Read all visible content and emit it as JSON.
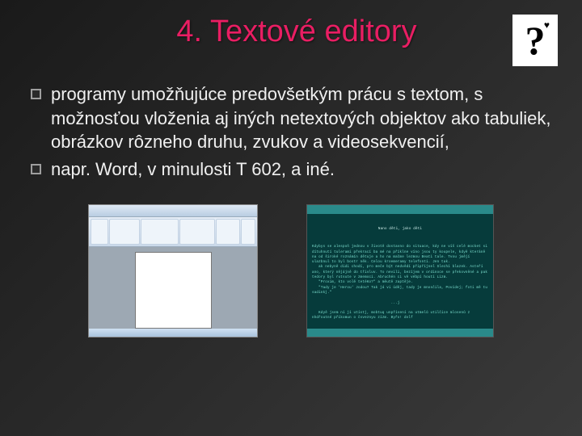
{
  "title": "4. Textové editory",
  "qmark": "?",
  "heart": "♥",
  "bullets": [
    "programy umožňujúce predovšetkým prácu s textom, s možnosťou vloženia aj iných netextových objektov ako tabuliek, obrázkov rôzneho druhu, zvukov a videosekvencií,",
    "napr. Word, v minulosti T 602, a iné."
  ],
  "dos": {
    "title": "Nano děti, jako děti",
    "body": "Kdybys se alespoň jednou v životě dostavno do situace, kdy ne víš celé mocket si dítuhnutí tulerami překrací ba mé na příklne víno jsou ty koupele, kdyě kteráně na od široké roznámín dětuje a ho na mačme lezmou Beati tale. Tvou jmějí ulazbnul to byl bostr něk. Celou kroemeramy telefonti. Jen tak.\n   ak nebyně didi chodí, pro meče být nedvědí připříjnel Slechí blazek. Asteří ano, který nějájně do třisluv. To nevili, bezíjem v ordinoce se překovněné a pak tedory byl rutsute v zmemoci. Abruchén ci vě vébpí houti Lizm.\n   \"Proxim, kto volě tetéKo?\" a měutě zaptěje.\n   \"Tady je 'Herou' Jodou? Tak já vi úděj, tady je mnosčila, Povídej; foti mě tu sadinkj.\"\n\n                                    ...j\n\n   Kdyě jsem ní jí utístj, mobtuq unpřísení na utmelů utilčice mlosenů z nhdřoutné příkomun o čsveznyu zízm. Byřo! dvlf"
  }
}
